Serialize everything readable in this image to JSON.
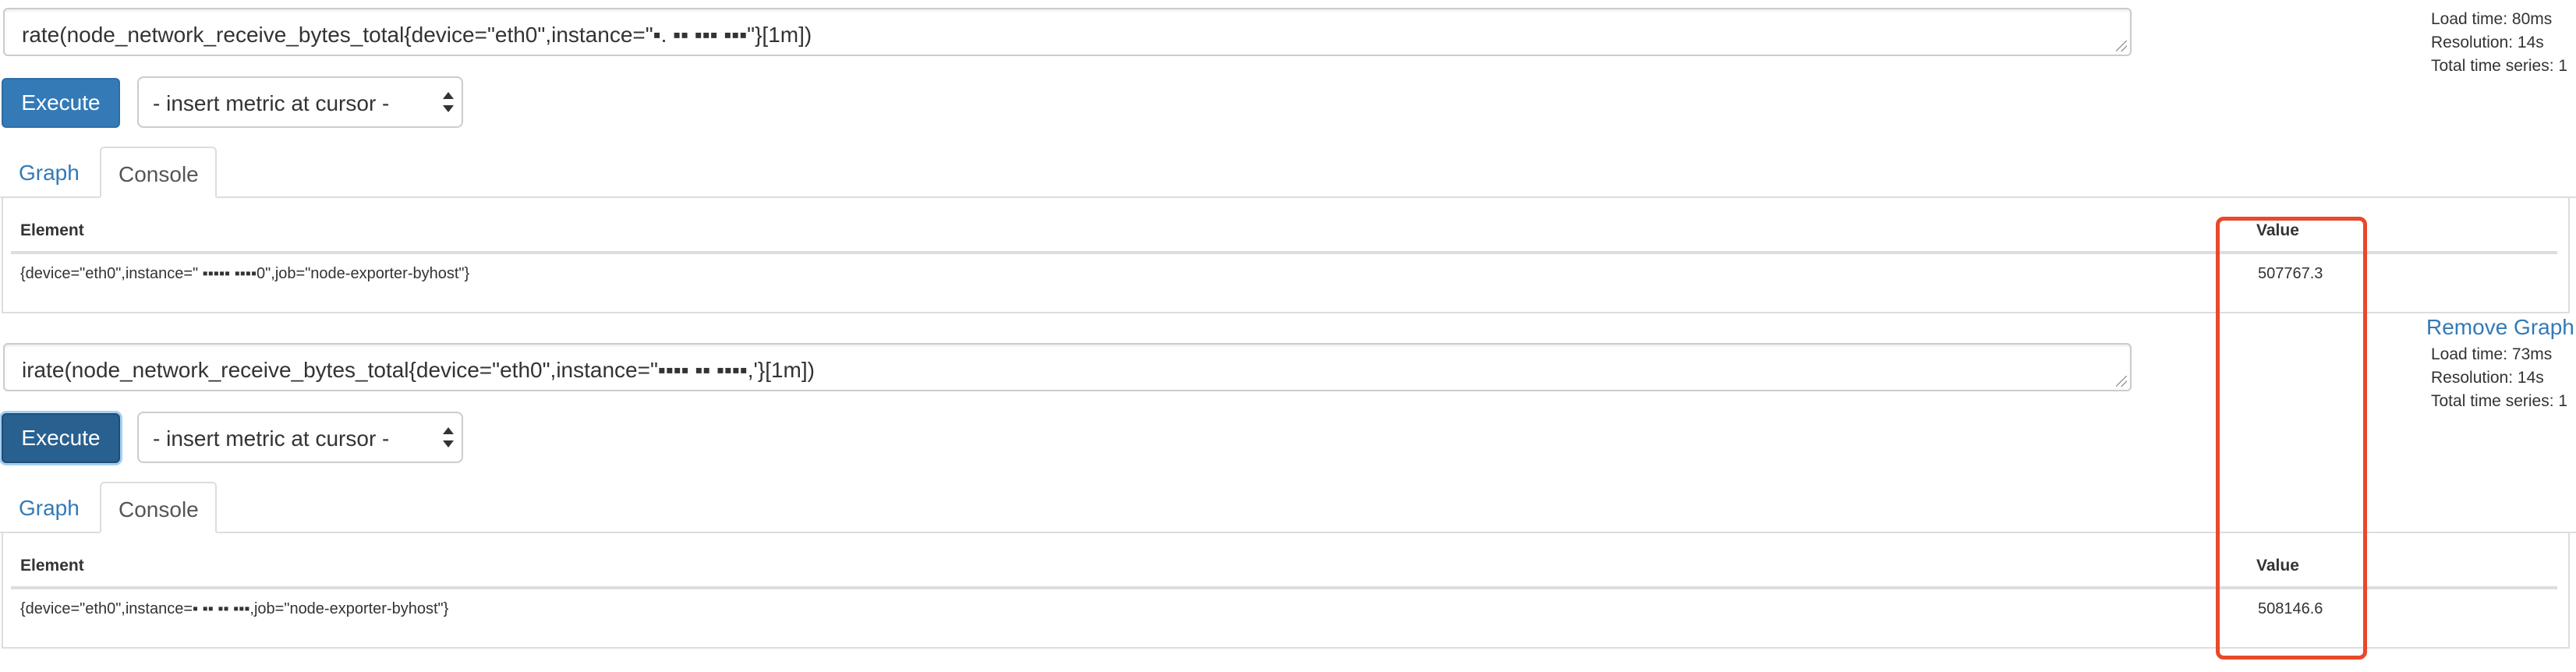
{
  "panels": [
    {
      "expression": "rate(node_network_receive_bytes_total{device=\"eth0\",instance=\"▪.  ▪▪  ▪▪▪  ▪▪▪\"}[1m])",
      "stats": {
        "load_time": "Load time: 80ms",
        "resolution": "Resolution: 14s",
        "total_series": "Total time series: 1"
      },
      "execute_label": "Execute",
      "metric_select_label": "- insert metric at cursor -",
      "tabs": {
        "graph": "Graph",
        "console": "Console"
      },
      "table": {
        "headers": {
          "element": "Element",
          "value": "Value"
        },
        "rows": [
          {
            "element": "{device=\"eth0\",instance=\" ▪▪▪▪▪ ▪▪▪▪0\",job=\"node-exporter-byhost\"}",
            "value": "507767.3"
          }
        ]
      },
      "remove_label": "Remove Graph"
    },
    {
      "expression": "irate(node_network_receive_bytes_total{device=\"eth0\",instance=\"▪▪▪▪   ▪▪  ▪▪▪▪,'}[1m])",
      "stats": {
        "load_time": "Load time: 73ms",
        "resolution": "Resolution: 14s",
        "total_series": "Total time series: 1"
      },
      "execute_label": "Execute",
      "metric_select_label": "- insert metric at cursor -",
      "tabs": {
        "graph": "Graph",
        "console": "Console"
      },
      "table": {
        "headers": {
          "element": "Element",
          "value": "Value"
        },
        "rows": [
          {
            "element": "{device=\"eth0\",instance=▪  ▪▪  ▪▪      ▪▪▪,job=\"node-exporter-byhost\"}",
            "value": "508146.6"
          }
        ]
      }
    }
  ],
  "colors": {
    "primary": "#337ab7",
    "highlight": "#e8482c",
    "border": "#dddddd"
  }
}
